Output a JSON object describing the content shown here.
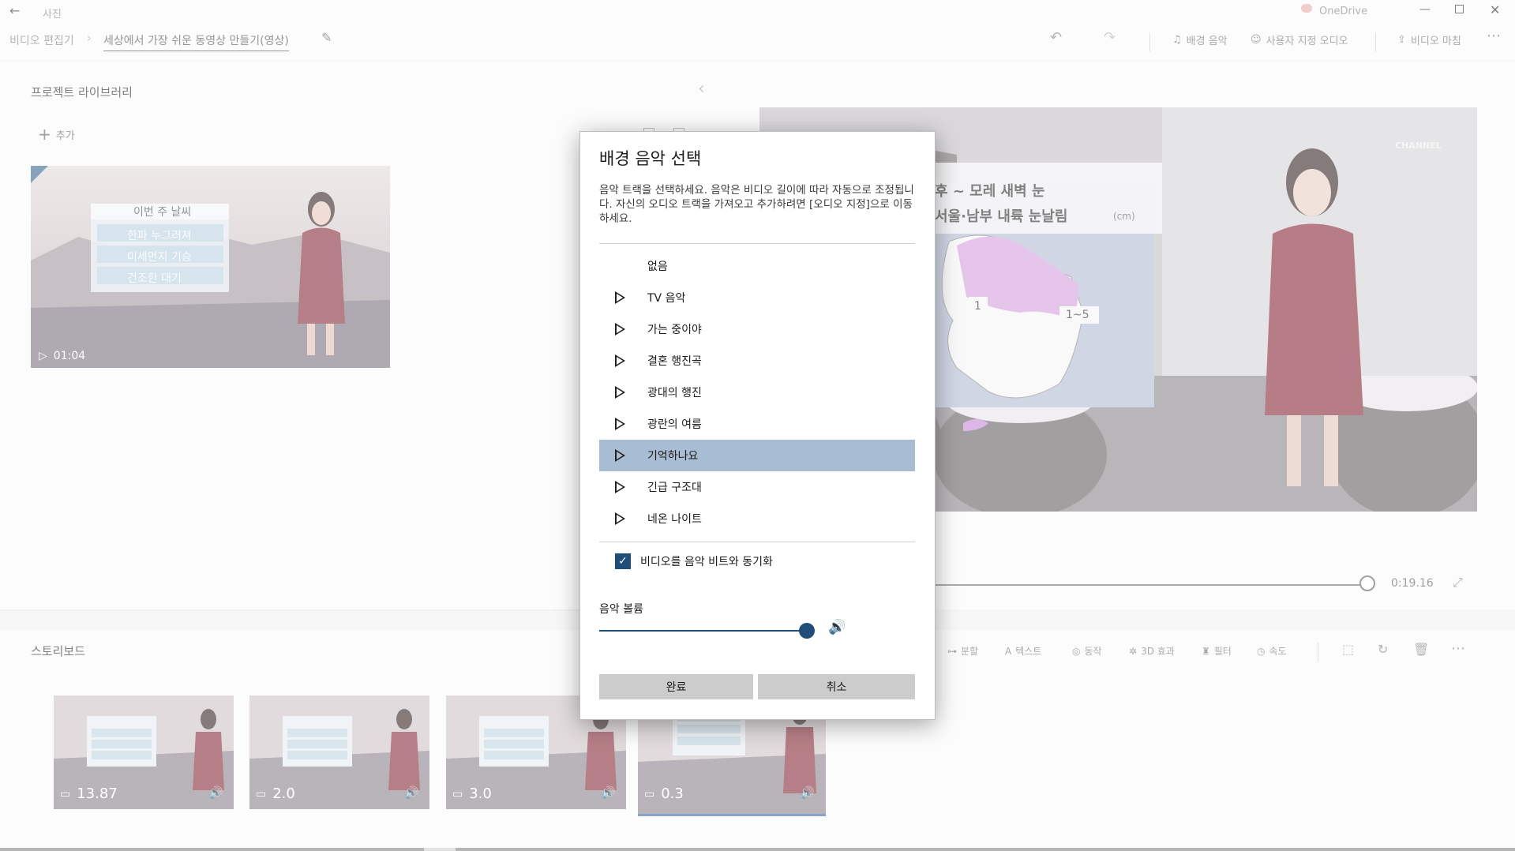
{
  "app": {
    "title": "사진",
    "onedrive": "OneDrive"
  },
  "toolbar": {
    "breadcrumb_root": "비디오 편집기",
    "project_name": "세상에서 가장 쉬운 동영상 만들기(영상)",
    "bg_music": "배경 음악",
    "custom_audio": "사용자 지정 오디오",
    "finish_video": "비디오 마침"
  },
  "library": {
    "title": "프로젝트 라이브러리",
    "add": "추가",
    "clip_duration": "01:04",
    "clip_overlay_title": "이번 주 날씨",
    "clip_overlay_lines": [
      "한파 누그러져",
      "미세먼지 기승",
      "건조한 대기"
    ]
  },
  "preview": {
    "overlay_line1": "후 ~ 모레 새벽 눈",
    "overlay_line2": "서울·남부 내륙 눈날림",
    "overlay_unit": "(cm)",
    "map_label_1": "1",
    "map_label_2": "1~5",
    "brand": "CHANNEL",
    "time": "0:19.16"
  },
  "storyboard": {
    "title": "스토리보드",
    "tools": [
      "분할",
      "텍스트",
      "동작",
      "3D 효과",
      "필터",
      "속도"
    ],
    "clips": [
      {
        "duration": "13.87"
      },
      {
        "duration": "2.0"
      },
      {
        "duration": "3.0"
      },
      {
        "duration": "0.3"
      }
    ]
  },
  "dialog": {
    "title": "배경 음악 선택",
    "description": "음악 트랙을 선택하세요. 음악은 비디오 길이에 따라 자동으로 조정됩니다. 자신의 오디오 트랙을 가져오고 추가하려면 [오디오 지정]으로 이동하세요.",
    "none_option": "없음",
    "tracks": [
      "TV 음악",
      "가는 중이야",
      "결혼 행진곡",
      "광대의 행진",
      "광란의 여름",
      "기억하나요",
      "긴급 구조대",
      "네온 나이트"
    ],
    "selected_track": "기억하나요",
    "sync_label": "비디오를 음악 비트와 동기화",
    "sync_checked": true,
    "volume_label": "음악 볼륨",
    "volume_level": 1.0,
    "done": "완료",
    "cancel": "취소"
  },
  "colors": {
    "selected": "#a8bdd3",
    "checkbox": "#1f4e79",
    "slider": "#1f4e79",
    "button": "#cccccc"
  }
}
